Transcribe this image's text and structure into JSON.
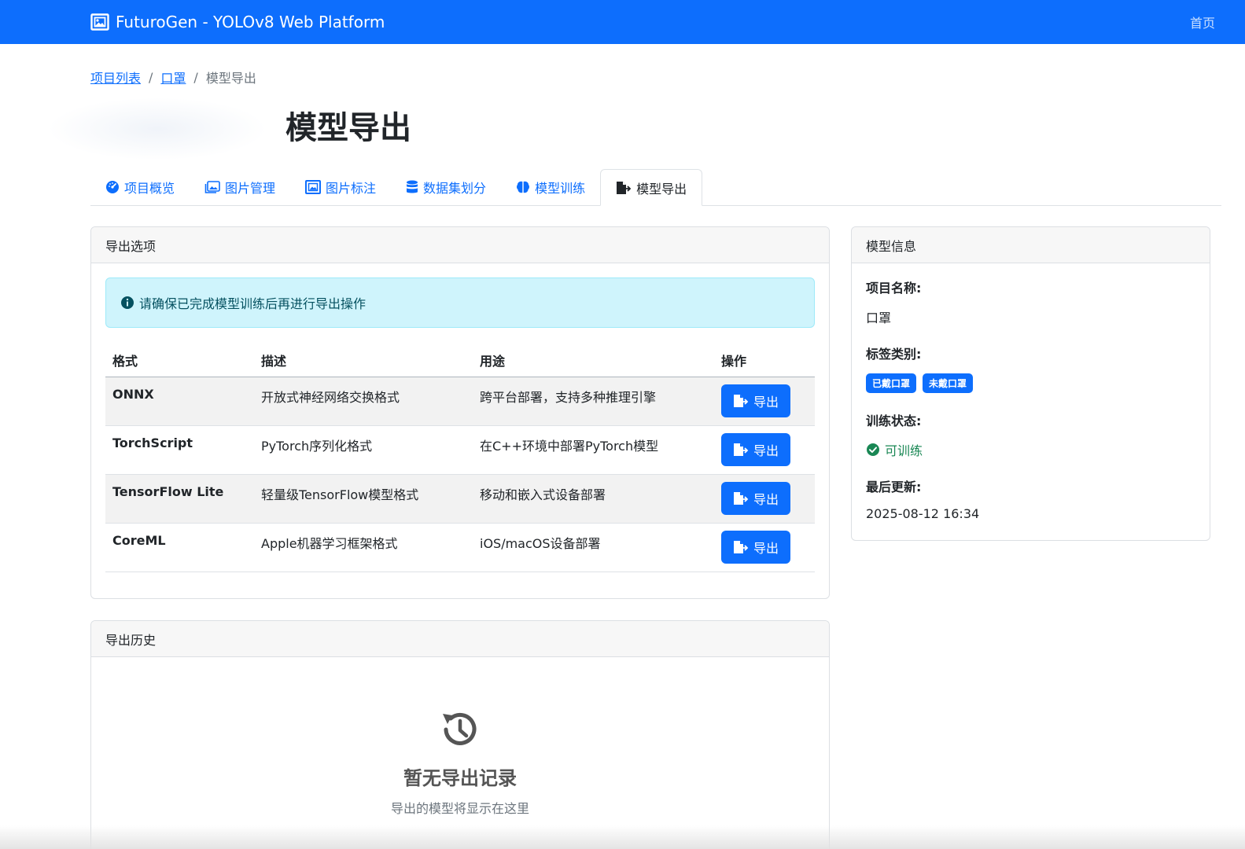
{
  "navbar": {
    "brand": "FuturoGen - YOLOv8 Web Platform",
    "brand_icon": "image-icon",
    "home_link": "首页",
    "color": "#0d6efd"
  },
  "breadcrumb": {
    "items": [
      "项目列表",
      "口罩"
    ],
    "separator": "/",
    "current": "模型导出"
  },
  "page": {
    "title": "模型导出"
  },
  "tabs": [
    {
      "label": "项目概览",
      "icon": "speedometer-icon"
    },
    {
      "label": "图片管理",
      "icon": "images-icon"
    },
    {
      "label": "图片标注",
      "icon": "bounding-box-icon"
    },
    {
      "label": "数据集划分",
      "icon": "database-icon"
    },
    {
      "label": "模型训练",
      "icon": "brain-icon"
    },
    {
      "label": "模型导出",
      "icon": "file-export-icon",
      "active": true
    }
  ],
  "export_options": {
    "header": "导出选项",
    "alert": "请确保已完成模型训练后再进行导出操作",
    "columns": [
      "格式",
      "描述",
      "用途",
      "操作"
    ],
    "rows": [
      {
        "format": "ONNX",
        "description": "开放式神经网络交换格式",
        "usage": "跨平台部署，支持多种推理引擎",
        "button": "导出"
      },
      {
        "format": "TorchScript",
        "description": "PyTorch序列化格式",
        "usage": "在C++环境中部署PyTorch模型",
        "button": "导出"
      },
      {
        "format": "TensorFlow Lite",
        "description": "轻量级TensorFlow模型格式",
        "usage": "移动和嵌入式设备部署",
        "button": "导出"
      },
      {
        "format": "CoreML",
        "description": "Apple机器学习框架格式",
        "usage": "iOS/macOS设备部署",
        "button": "导出"
      }
    ]
  },
  "export_history": {
    "header": "导出历史",
    "empty_icon": "history-icon",
    "empty_title": "暂无导出记录",
    "empty_subtitle": "导出的模型将显示在这里"
  },
  "model_info": {
    "header": "模型信息",
    "project_name_label": "项目名称:",
    "project_name": "口罩",
    "labels_label": "标签类别:",
    "labels": [
      "已戴口罩",
      "未戴口罩"
    ],
    "status_label": "训练状态:",
    "status": "可训练",
    "status_color": "#198754",
    "updated_label": "最后更新:",
    "updated": "2025-08-12 16:34"
  }
}
